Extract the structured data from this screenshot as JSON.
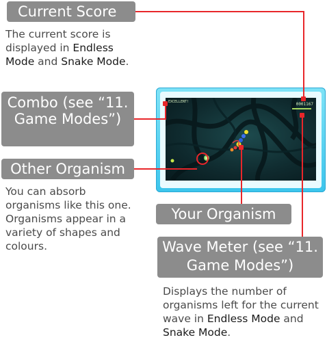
{
  "current_score": {
    "title": "Current Score",
    "desc_pre": "The current score is displayed in ",
    "mode1": "Endless Mode",
    "desc_mid": " and ",
    "mode2": "Snake Mode",
    "desc_post": "."
  },
  "combo": {
    "title": "Combo (see “11. Game Modes”)"
  },
  "other_organism": {
    "title": "Other Organism",
    "desc": "You can absorb organisms like this one. Organisms appear in a variety of shapes and colours."
  },
  "your_organism": {
    "title": "Your Organism"
  },
  "wave_meter": {
    "title": "Wave Meter (see “11. Game Modes”)",
    "desc_pre": "Displays the number of organisms left for the current wave in ",
    "mode1": "Endless Mode",
    "desc_mid": " and ",
    "mode2": "Snake Mode",
    "desc_post": "."
  },
  "game": {
    "combo_text": "EXCELLENT!",
    "score_text": "0001167"
  },
  "colors": {
    "callout_bg": "#8c8c8c",
    "leader_line": "#e8262a",
    "screen_frame": "#3cc5ec"
  }
}
